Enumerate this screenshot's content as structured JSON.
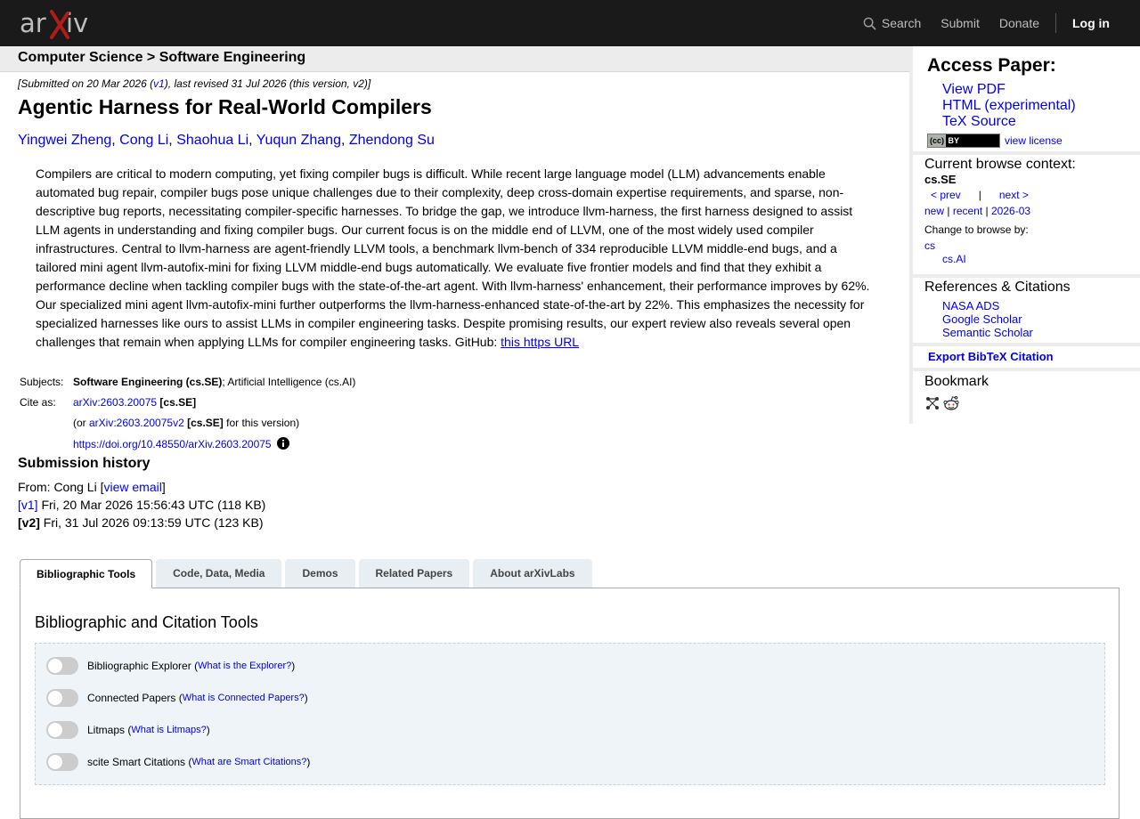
{
  "header": {
    "logo_text": "arXiv",
    "nav": {
      "search": "Search",
      "submit": "Submit",
      "donate": "Donate",
      "login": "Log in"
    }
  },
  "breadcrumb": "Computer Science > Software Engineering",
  "paper": {
    "dateline_pre": "[Submitted on 20 Mar 2026 (",
    "dateline_v1": "v1",
    "dateline_post": "), last revised 31 Jul 2026 (this version, v2)]",
    "title": "Agentic Harness for Real-World Compilers",
    "authors": [
      "Yingwei Zheng",
      "Cong Li",
      "Shaohua Li",
      "Yuqun Zhang",
      "Zhendong Su"
    ],
    "author_sep": ", ",
    "abstract": "Compilers are critical to modern computing, yet fixing compiler bugs is difficult. While recent large language model (LLM) advancements enable automated bug repair, compiler bugs pose unique challenges due to their complexity, deep cross-domain expertise requirements, and sparse, non-descriptive bug reports, necessitating compiler-specific harnesses. To bridge the gap, we introduce llvm-harness, the first harness designed to assist LLM agents in understanding and fixing compiler bugs. Our current focus is on the middle end of LLVM, one of the most widely used compiler infrastructures. Central to llvm-harness are agent-friendly LLVM tools, a benchmark llvm-bench of 334 reproducible LLVM middle-end bugs, and a tailored mini agent llvm-autofix-mini for fixing LLVM middle-end bugs automatically. We evaluate five frontier models and find that they exhibit a performance decline when tackling compiler bugs with the state-of-the-art agent. With llvm-harness' enhancement, their performance improves by 62%. Our specialized mini agent llvm-autofix-mini further outperforms the llvm-harness-enhanced state-of-the-art by 22%. This emphasizes the necessity for specialized harnesses like ours to assist LLMs in compiler engineering tasks. Despite promising results, our expert review also reveals several open challenges that remain when applying LLMs for compiler engineering tasks. GitHub: ",
    "abstract_link": "this https URL",
    "subjects_label": "Subjects:",
    "subjects_primary": "Software Engineering (cs.SE)",
    "subjects_rest": "; Artificial Intelligence (cs.AI)",
    "cite_label": "Cite as:",
    "cite_id": "arXiv:2603.20075",
    "cite_tag": "[cs.SE]",
    "cite2_pre": "(or ",
    "cite2_id": "arXiv:2603.20075v2",
    "cite2_tag": "[cs.SE]",
    "cite2_post": " for this version)",
    "doi": "https://doi.org/10.48550/arXiv.2603.20075"
  },
  "history": {
    "heading": "Submission history",
    "from_pre": "From: Cong Li [",
    "from_link": "view email",
    "from_post": "]",
    "v1_label": "[v1]",
    "v1_text": " Fri, 20 Mar 2026 15:56:43 UTC (118 KB)",
    "v2_label": "[v2]",
    "v2_text": " Fri, 31 Jul 2026 09:13:59 UTC (123 KB)"
  },
  "tabs": [
    "Bibliographic Tools",
    "Code, Data, Media",
    "Demos",
    "Related Papers",
    "About arXivLabs"
  ],
  "panel": {
    "heading": "Bibliographic and Citation Tools",
    "tools": [
      {
        "name": "Bibliographic Explorer",
        "what": "What is the Explorer?"
      },
      {
        "name": "Connected Papers",
        "what": "What is Connected Papers?"
      },
      {
        "name": "Litmaps",
        "what": "What is Litmaps?"
      },
      {
        "name": "scite Smart Citations",
        "what": "What are Smart Citations?"
      }
    ]
  },
  "sidebar": {
    "access_heading": "Access Paper:",
    "access_links": [
      "View PDF",
      "HTML (experimental)",
      "TeX Source"
    ],
    "license_link": "view license",
    "license_badge": [
      "(cc)",
      "BY"
    ],
    "browse_heading": "Current browse context:",
    "browse_context": "cs.SE",
    "prev": "< prev",
    "pipe": "|",
    "next": "next >",
    "new": "new",
    "recent": "recent",
    "month": "2026-03",
    "change_label": "Change to browse by:",
    "cs": "cs",
    "cs_ai": "cs.AI",
    "refs_heading": "References & Citations",
    "refs_links": [
      "NASA ADS",
      "Google Scholar",
      "Semantic Scholar"
    ],
    "export": "Export BibTeX Citation",
    "bookmark_heading": "Bookmark"
  }
}
